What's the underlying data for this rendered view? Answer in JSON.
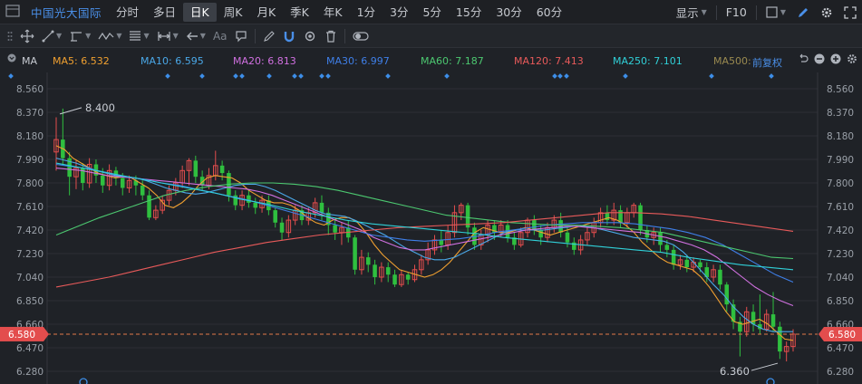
{
  "toolbar": {
    "stock_name": "中国光大国际",
    "periods": [
      "分时",
      "多日",
      "日K",
      "周K",
      "月K",
      "季K",
      "年K",
      "1分",
      "3分",
      "5分",
      "15分",
      "30分",
      "60分"
    ],
    "active_period": "日K",
    "display_label": "显示",
    "f10_label": "F10"
  },
  "draw_toolbar": {
    "tools": [
      "move-icon",
      "line-icon",
      "channel-icon",
      "wave-icon",
      "fib-icon",
      "range-icon",
      "arrow-left-icon",
      "text-icon",
      "note-icon",
      "pen-icon",
      "magnet-icon",
      "eye-icon",
      "trash-icon",
      "toggle-icon"
    ],
    "text_tool_label": "Aa"
  },
  "ma_legend": {
    "indicator_label": "MA",
    "items": [
      {
        "label": "MA5: 6.532",
        "color": "#f0a030"
      },
      {
        "label": "MA10: 6.595",
        "color": "#4aa8e8"
      },
      {
        "label": "MA20: 6.813",
        "color": "#d070e0"
      },
      {
        "label": "MA30: 6.997",
        "color": "#3f7fe8"
      },
      {
        "label": "MA60: 7.187",
        "color": "#4cc870"
      },
      {
        "label": "MA120: 7.413",
        "color": "#e85a5a"
      },
      {
        "label": "MA250: 7.101",
        "color": "#30d0d8"
      },
      {
        "label": "MA500:",
        "color": "#9a8a50"
      }
    ],
    "adjust_label": "前复权"
  },
  "chart_data": {
    "type": "candlestick",
    "y_ticks": [
      "8.560",
      "8.370",
      "8.180",
      "7.990",
      "7.800",
      "7.610",
      "7.420",
      "7.230",
      "7.040",
      "6.850",
      "6.660",
      "6.470",
      "6.280"
    ],
    "ylim": [
      6.28,
      8.56
    ],
    "current_price": "6.580",
    "high_annotation": "8.400",
    "low_annotation": "6.360",
    "candles": [
      [
        8.05,
        8.15,
        8.33,
        7.9
      ],
      [
        8.15,
        8.0,
        8.4,
        7.95
      ],
      [
        8.0,
        7.85,
        8.05,
        7.7
      ],
      [
        7.85,
        7.92,
        7.98,
        7.75
      ],
      [
        7.92,
        7.8,
        7.96,
        7.74
      ],
      [
        7.8,
        7.95,
        8.0,
        7.76
      ],
      [
        7.95,
        7.86,
        7.99,
        7.8
      ],
      [
        7.86,
        7.78,
        7.92,
        7.72
      ],
      [
        7.78,
        7.9,
        7.95,
        7.74
      ],
      [
        7.9,
        7.84,
        7.93,
        7.78
      ],
      [
        7.84,
        7.76,
        7.88,
        7.7
      ],
      [
        7.76,
        7.82,
        7.86,
        7.72
      ],
      [
        7.82,
        7.78,
        7.86,
        7.7
      ],
      [
        7.78,
        7.7,
        7.82,
        7.66
      ],
      [
        7.7,
        7.52,
        7.74,
        7.5
      ],
      [
        7.52,
        7.58,
        7.62,
        7.5
      ],
      [
        7.58,
        7.66,
        7.7,
        7.55
      ],
      [
        7.66,
        7.74,
        7.78,
        7.62
      ],
      [
        7.74,
        7.8,
        7.84,
        7.7
      ],
      [
        7.8,
        7.9,
        7.94,
        7.76
      ],
      [
        7.9,
        7.98,
        8.0,
        7.78
      ],
      [
        7.98,
        7.85,
        8.02,
        7.8
      ],
      [
        7.85,
        7.78,
        7.9,
        7.74
      ],
      [
        7.78,
        7.86,
        7.92,
        7.75
      ],
      [
        7.86,
        7.94,
        8.06,
        7.82
      ],
      [
        7.94,
        7.88,
        7.98,
        7.82
      ],
      [
        7.88,
        7.7,
        7.9,
        7.65
      ],
      [
        7.7,
        7.62,
        7.74,
        7.58
      ],
      [
        7.62,
        7.7,
        7.74,
        7.58
      ],
      [
        7.7,
        7.64,
        7.74,
        7.6
      ],
      [
        7.64,
        7.6,
        7.68,
        7.55
      ],
      [
        7.6,
        7.66,
        7.7,
        7.56
      ],
      [
        7.66,
        7.58,
        7.7,
        7.54
      ],
      [
        7.58,
        7.48,
        7.6,
        7.44
      ],
      [
        7.48,
        7.4,
        7.52,
        7.34
      ],
      [
        7.4,
        7.5,
        7.54,
        7.36
      ],
      [
        7.5,
        7.58,
        7.62,
        7.46
      ],
      [
        7.58,
        7.5,
        7.62,
        7.46
      ],
      [
        7.5,
        7.56,
        7.6,
        7.46
      ],
      [
        7.56,
        7.64,
        7.68,
        7.52
      ],
      [
        7.64,
        7.56,
        7.7,
        7.5
      ],
      [
        7.56,
        7.46,
        7.6,
        7.38
      ],
      [
        7.46,
        7.4,
        7.5,
        7.34
      ],
      [
        7.4,
        7.44,
        7.48,
        7.3
      ],
      [
        7.44,
        7.36,
        7.5,
        7.32
      ],
      [
        7.36,
        7.1,
        7.38,
        7.06
      ],
      [
        7.1,
        7.2,
        7.26,
        7.06
      ],
      [
        7.2,
        7.14,
        7.24,
        7.08
      ],
      [
        7.14,
        7.04,
        7.18,
        6.98
      ],
      [
        7.04,
        7.12,
        7.16,
        7.0
      ],
      [
        7.12,
        7.06,
        7.16,
        7.0
      ],
      [
        7.06,
        6.98,
        7.1,
        6.96
      ],
      [
        6.98,
        7.06,
        7.1,
        6.96
      ],
      [
        7.06,
        7.02,
        7.08,
        6.98
      ],
      [
        7.02,
        7.1,
        7.14,
        7.0
      ],
      [
        7.1,
        7.18,
        7.22,
        7.06
      ],
      [
        7.18,
        7.26,
        7.32,
        7.14
      ],
      [
        7.26,
        7.34,
        7.38,
        7.22
      ],
      [
        7.34,
        7.3,
        7.42,
        7.24
      ],
      [
        7.3,
        7.4,
        7.46,
        7.26
      ],
      [
        7.4,
        7.56,
        7.62,
        7.36
      ],
      [
        7.56,
        7.62,
        7.64,
        7.5
      ],
      [
        7.62,
        7.44,
        7.64,
        7.38
      ],
      [
        7.44,
        7.3,
        7.48,
        7.26
      ],
      [
        7.3,
        7.38,
        7.42,
        7.26
      ],
      [
        7.38,
        7.46,
        7.5,
        7.32
      ],
      [
        7.46,
        7.4,
        7.5,
        7.34
      ],
      [
        7.4,
        7.46,
        7.5,
        7.36
      ],
      [
        7.46,
        7.36,
        7.5,
        7.32
      ],
      [
        7.36,
        7.3,
        7.4,
        7.26
      ],
      [
        7.3,
        7.4,
        7.44,
        7.28
      ],
      [
        7.4,
        7.5,
        7.52,
        7.36
      ],
      [
        7.5,
        7.42,
        7.54,
        7.38
      ],
      [
        7.42,
        7.36,
        7.46,
        7.3
      ],
      [
        7.36,
        7.44,
        7.48,
        7.32
      ],
      [
        7.44,
        7.5,
        7.54,
        7.4
      ],
      [
        7.5,
        7.4,
        7.56,
        7.36
      ],
      [
        7.4,
        7.32,
        7.44,
        7.28
      ],
      [
        7.32,
        7.26,
        7.36,
        7.22
      ],
      [
        7.26,
        7.34,
        7.38,
        7.22
      ],
      [
        7.34,
        7.4,
        7.44,
        7.3
      ],
      [
        7.4,
        7.48,
        7.52,
        7.36
      ],
      [
        7.48,
        7.56,
        7.6,
        7.44
      ],
      [
        7.56,
        7.5,
        7.62,
        7.46
      ],
      [
        7.5,
        7.58,
        7.64,
        7.46
      ],
      [
        7.58,
        7.48,
        7.62,
        7.44
      ],
      [
        7.48,
        7.56,
        7.6,
        7.44
      ],
      [
        7.56,
        7.62,
        7.64,
        7.52
      ],
      [
        7.62,
        7.42,
        7.64,
        7.38
      ],
      [
        7.42,
        7.36,
        7.46,
        7.32
      ],
      [
        7.36,
        7.4,
        7.44,
        7.3
      ],
      [
        7.4,
        7.3,
        7.44,
        7.24
      ],
      [
        7.3,
        7.26,
        7.34,
        7.2
      ],
      [
        7.26,
        7.14,
        7.3,
        7.1
      ],
      [
        7.14,
        7.18,
        7.22,
        7.1
      ],
      [
        7.18,
        7.12,
        7.22,
        7.08
      ],
      [
        7.12,
        7.16,
        7.2,
        7.08
      ],
      [
        7.16,
        7.12,
        7.18,
        7.08
      ],
      [
        7.12,
        7.04,
        7.16,
        7.0
      ],
      [
        7.04,
        7.1,
        7.14,
        7.0
      ],
      [
        7.1,
        6.98,
        7.14,
        6.94
      ],
      [
        6.98,
        6.82,
        7.0,
        6.76
      ],
      [
        6.82,
        6.68,
        6.86,
        6.62
      ],
      [
        6.68,
        6.6,
        6.72,
        6.4
      ],
      [
        6.6,
        6.76,
        6.8,
        6.56
      ],
      [
        6.76,
        6.66,
        6.82,
        6.6
      ],
      [
        6.66,
        6.62,
        6.9,
        6.58
      ],
      [
        6.62,
        6.74,
        6.78,
        6.6
      ],
      [
        6.74,
        6.64,
        6.92,
        6.6
      ],
      [
        6.64,
        6.44,
        6.68,
        6.38
      ],
      [
        6.44,
        6.48,
        6.52,
        6.36
      ],
      [
        6.48,
        6.58,
        6.62,
        6.44
      ]
    ],
    "ma_lines": {
      "MA5": [
        8.1,
        8.07,
        8.0,
        7.96,
        7.92,
        7.88,
        7.86,
        7.84,
        7.85,
        7.84,
        7.8,
        7.76,
        7.7,
        7.62,
        7.6,
        7.64,
        7.7,
        7.78,
        7.84,
        7.86,
        7.85,
        7.84,
        7.8,
        7.74,
        7.7,
        7.66,
        7.64,
        7.64,
        7.62,
        7.58,
        7.52,
        7.48,
        7.46,
        7.5,
        7.52,
        7.52,
        7.48,
        7.4,
        7.3,
        7.22,
        7.16,
        7.1,
        7.08,
        7.06,
        7.04,
        7.06,
        7.1,
        7.16,
        7.24,
        7.32,
        7.4,
        7.44,
        7.42,
        7.4,
        7.4,
        7.42,
        7.44,
        7.42,
        7.4,
        7.38,
        7.4,
        7.42,
        7.44,
        7.46,
        7.48,
        7.5,
        7.52,
        7.5,
        7.46,
        7.4,
        7.32,
        7.26,
        7.2,
        7.16,
        7.14,
        7.12,
        7.1,
        7.04,
        6.96,
        6.86,
        6.76,
        6.68,
        6.66,
        6.68,
        6.7,
        6.66,
        6.6,
        6.54,
        6.53
      ],
      "MA10": [
        8.0,
        7.98,
        7.96,
        7.93,
        7.9,
        7.88,
        7.86,
        7.85,
        7.84,
        7.82,
        7.79,
        7.76,
        7.74,
        7.72,
        7.71,
        7.72,
        7.74,
        7.76,
        7.78,
        7.79,
        7.79,
        7.77,
        7.74,
        7.7,
        7.66,
        7.62,
        7.58,
        7.55,
        7.54,
        7.53,
        7.5,
        7.46,
        7.42,
        7.38,
        7.33,
        7.28,
        7.24,
        7.2,
        7.18,
        7.18,
        7.2,
        7.24,
        7.28,
        7.32,
        7.36,
        7.4,
        7.42,
        7.42,
        7.42,
        7.42,
        7.43,
        7.44,
        7.45,
        7.45,
        7.44,
        7.42,
        7.4,
        7.38,
        7.36,
        7.35,
        7.34,
        7.33,
        7.3,
        7.24,
        7.16,
        7.07,
        6.98,
        6.9,
        6.8,
        6.72,
        6.66,
        6.62,
        6.6,
        6.6,
        6.6
      ],
      "MA20": [
        7.92,
        7.91,
        7.9,
        7.88,
        7.86,
        7.85,
        7.84,
        7.83,
        7.82,
        7.81,
        7.8,
        7.79,
        7.78,
        7.77,
        7.76,
        7.75,
        7.73,
        7.7,
        7.66,
        7.62,
        7.58,
        7.54,
        7.5,
        7.46,
        7.42,
        7.36,
        7.32,
        7.28,
        7.26,
        7.26,
        7.28,
        7.3,
        7.32,
        7.34,
        7.36,
        7.38,
        7.4,
        7.42,
        7.43,
        7.44,
        7.45,
        7.45,
        7.44,
        7.43,
        7.42,
        7.41,
        7.4,
        7.38,
        7.36,
        7.33,
        7.3,
        7.26,
        7.2,
        7.12,
        7.04,
        6.96,
        6.9,
        6.85,
        6.81
      ],
      "MA30": [
        7.95,
        7.93,
        7.91,
        7.88,
        7.85,
        7.83,
        7.8,
        7.78,
        7.75,
        7.72,
        7.69,
        7.66,
        7.62,
        7.58,
        7.54,
        7.5,
        7.46,
        7.42,
        7.38,
        7.36,
        7.34,
        7.33,
        7.34,
        7.35,
        7.37,
        7.4,
        7.42,
        7.44,
        7.46,
        7.47,
        7.48,
        7.48,
        7.48,
        7.47,
        7.45,
        7.43,
        7.4,
        7.36,
        7.3,
        7.22,
        7.14,
        7.06,
        7.0
      ],
      "MA60": [
        7.38,
        7.45,
        7.52,
        7.58,
        7.64,
        7.7,
        7.74,
        7.77,
        7.79,
        7.8,
        7.8,
        7.79,
        7.77,
        7.74,
        7.7,
        7.66,
        7.62,
        7.58,
        7.54,
        7.52,
        7.5,
        7.48,
        7.47,
        7.46,
        7.46,
        7.45,
        7.44,
        7.42,
        7.4,
        7.36,
        7.32,
        7.28,
        7.24,
        7.2,
        7.19
      ],
      "MA120": [
        6.96,
        7.0,
        7.04,
        7.09,
        7.14,
        7.19,
        7.24,
        7.28,
        7.32,
        7.35,
        7.38,
        7.4,
        7.42,
        7.44,
        7.45,
        7.46,
        7.47,
        7.48,
        7.5,
        7.52,
        7.54,
        7.56,
        7.56,
        7.55,
        7.53,
        7.5,
        7.47,
        7.44,
        7.41
      ],
      "MA250": [
        7.96,
        7.92,
        7.88,
        7.84,
        7.8,
        7.76,
        7.72,
        7.67,
        7.63,
        7.58,
        7.54,
        7.5,
        7.47,
        7.45,
        7.43,
        7.41,
        7.39,
        7.36,
        7.34,
        7.32,
        7.3,
        7.28,
        7.26,
        7.24,
        7.2,
        7.17,
        7.14,
        7.12,
        7.1
      ]
    }
  }
}
